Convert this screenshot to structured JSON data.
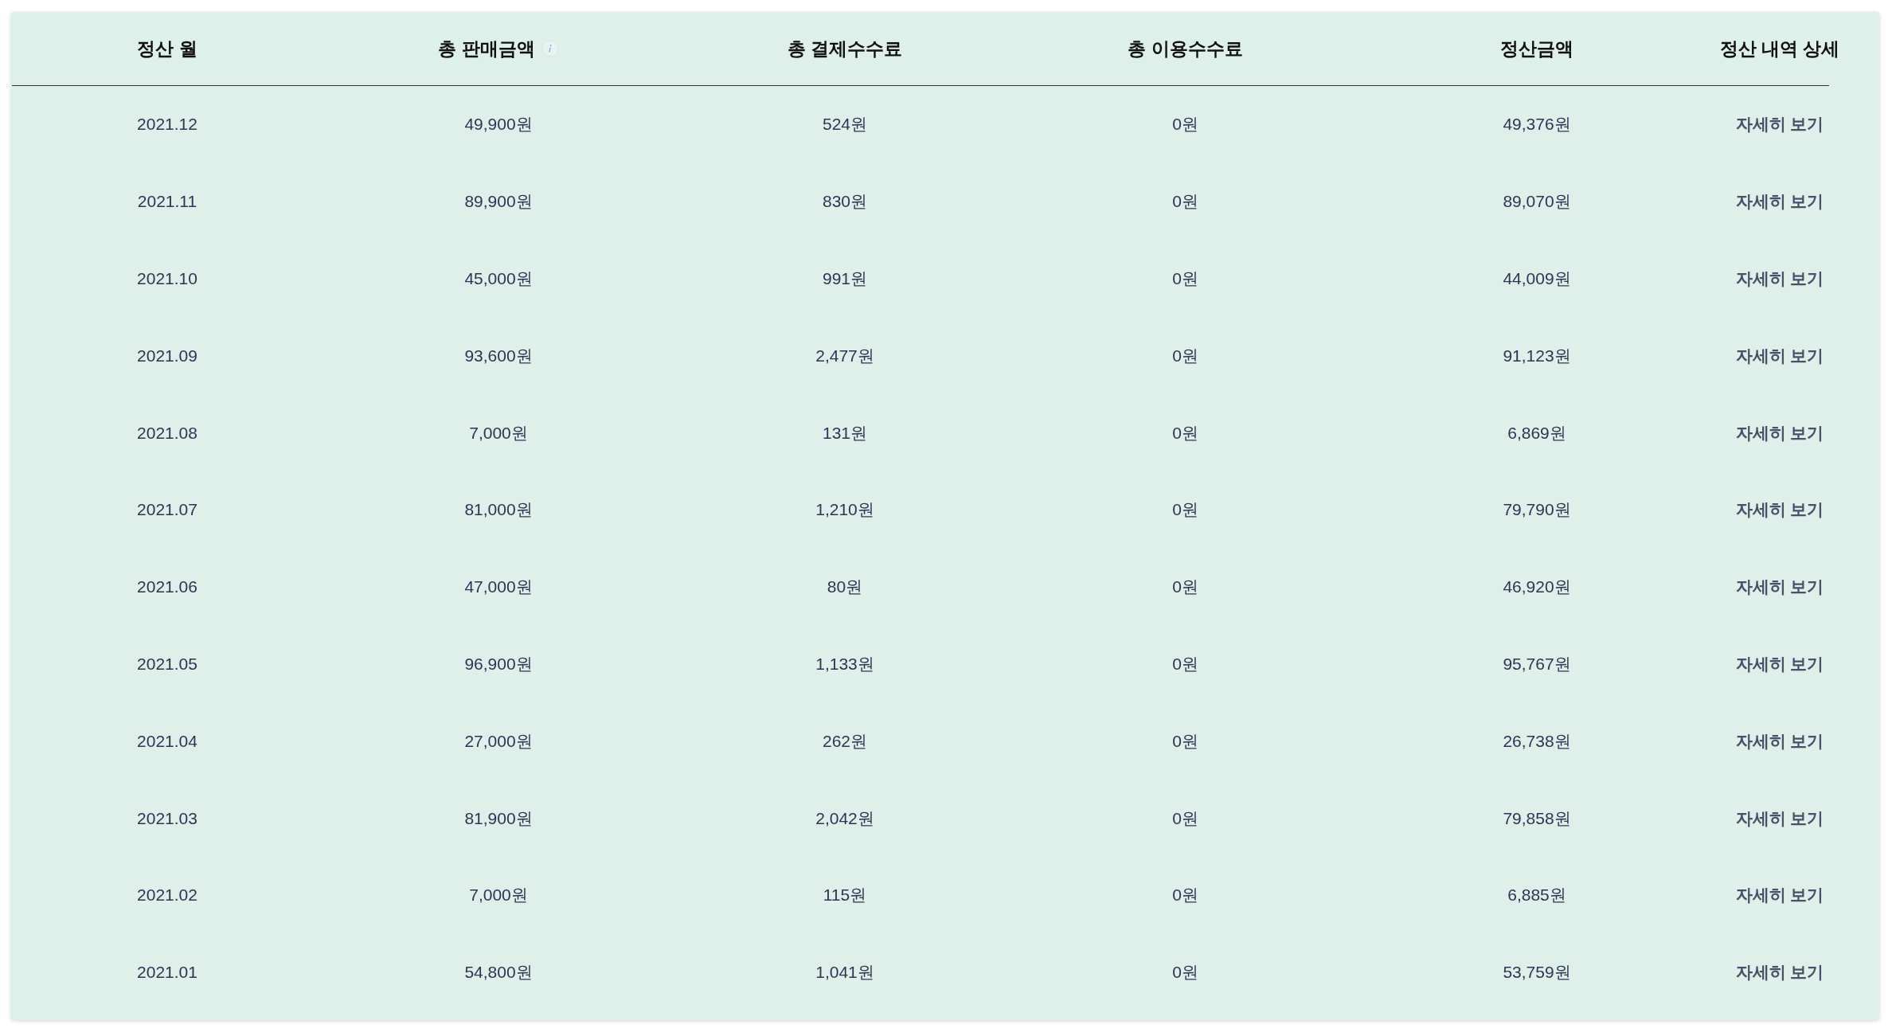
{
  "table": {
    "columns": [
      {
        "label": "정산 월",
        "info": false
      },
      {
        "label": "총 판매금액",
        "info": true
      },
      {
        "label": "총 결제수수료",
        "info": false
      },
      {
        "label": "총 이용수수료",
        "info": false
      },
      {
        "label": "정산금액",
        "info": false
      },
      {
        "label": "정산 내역 상세",
        "info": false
      }
    ],
    "rows": [
      {
        "month": "2021.12",
        "sales": "49,900원",
        "payment_fee": "524원",
        "usage_fee": "0원",
        "settlement": "49,376원",
        "detail": "자세히 보기"
      },
      {
        "month": "2021.11",
        "sales": "89,900원",
        "payment_fee": "830원",
        "usage_fee": "0원",
        "settlement": "89,070원",
        "detail": "자세히 보기"
      },
      {
        "month": "2021.10",
        "sales": "45,000원",
        "payment_fee": "991원",
        "usage_fee": "0원",
        "settlement": "44,009원",
        "detail": "자세히 보기"
      },
      {
        "month": "2021.09",
        "sales": "93,600원",
        "payment_fee": "2,477원",
        "usage_fee": "0원",
        "settlement": "91,123원",
        "detail": "자세히 보기"
      },
      {
        "month": "2021.08",
        "sales": "7,000원",
        "payment_fee": "131원",
        "usage_fee": "0원",
        "settlement": "6,869원",
        "detail": "자세히 보기"
      },
      {
        "month": "2021.07",
        "sales": "81,000원",
        "payment_fee": "1,210원",
        "usage_fee": "0원",
        "settlement": "79,790원",
        "detail": "자세히 보기"
      },
      {
        "month": "2021.06",
        "sales": "47,000원",
        "payment_fee": "80원",
        "usage_fee": "0원",
        "settlement": "46,920원",
        "detail": "자세히 보기"
      },
      {
        "month": "2021.05",
        "sales": "96,900원",
        "payment_fee": "1,133원",
        "usage_fee": "0원",
        "settlement": "95,767원",
        "detail": "자세히 보기"
      },
      {
        "month": "2021.04",
        "sales": "27,000원",
        "payment_fee": "262원",
        "usage_fee": "0원",
        "settlement": "26,738원",
        "detail": "자세히 보기"
      },
      {
        "month": "2021.03",
        "sales": "81,900원",
        "payment_fee": "2,042원",
        "usage_fee": "0원",
        "settlement": "79,858원",
        "detail": "자세히 보기"
      },
      {
        "month": "2021.02",
        "sales": "7,000원",
        "payment_fee": "115원",
        "usage_fee": "0원",
        "settlement": "6,885원",
        "detail": "자세히 보기"
      },
      {
        "month": "2021.01",
        "sales": "54,800원",
        "payment_fee": "1,041원",
        "usage_fee": "0원",
        "settlement": "53,759원",
        "detail": "자세히 보기"
      }
    ]
  }
}
